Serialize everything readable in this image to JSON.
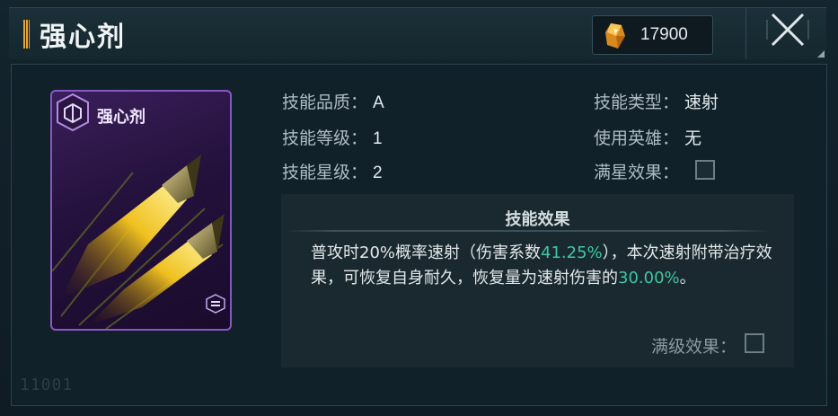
{
  "header": {
    "title": "强心剂",
    "currency_icon": "crystal-icon",
    "currency_value": "17900",
    "close_icon": "close-icon"
  },
  "card": {
    "name": "强心剂",
    "rarity_color": "#8a55c8",
    "art": "twin-missiles-art"
  },
  "stats": {
    "quality_label": "技能品质：",
    "quality_value": "A",
    "level_label": "技能等级：",
    "level_value": "1",
    "star_label": "技能星级：",
    "star_value": "2",
    "type_label": "技能类型：",
    "type_value": "速射",
    "hero_label": "使用英雄：",
    "hero_value": "无",
    "max_star_label": "满星效果："
  },
  "effect": {
    "title": "技能效果",
    "text_part1": "普攻时20%概率速射（伤害系数",
    "coef": "41.25%",
    "text_part2": "），本次速射附带治疗效果，可恢复自身耐久，恢复量为速射伤害的",
    "heal": "30.00%",
    "text_part3": "。",
    "highlight_color": "#3fc7a3"
  },
  "max_level_label": "满级效果：",
  "footer_code": "11001"
}
